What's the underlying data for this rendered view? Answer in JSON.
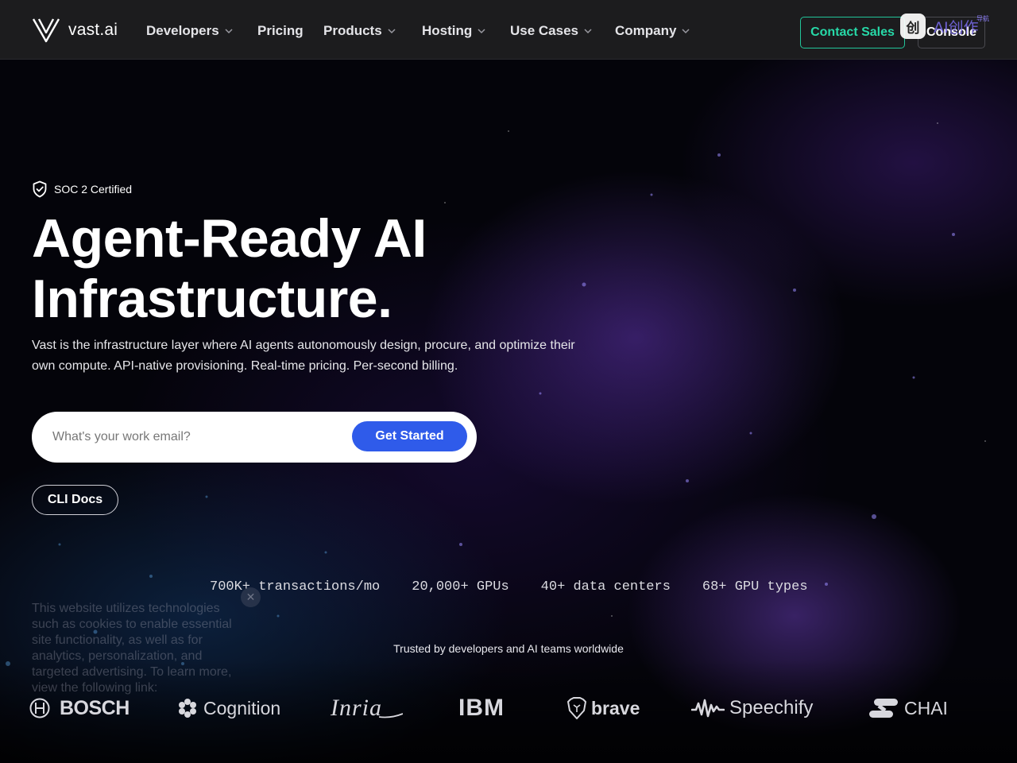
{
  "nav": {
    "brand": "vast.ai",
    "items": [
      {
        "label": "Developers",
        "dropdown": true
      },
      {
        "label": "Pricing",
        "dropdown": false
      },
      {
        "label": "Products",
        "dropdown": true
      },
      {
        "label": "Hosting",
        "dropdown": true
      },
      {
        "label": "Use Cases",
        "dropdown": true
      },
      {
        "label": "Company",
        "dropdown": true
      }
    ],
    "contact_label": "Contact Sales",
    "console_label": "Console"
  },
  "overlay": {
    "icon_text": "创",
    "text": "AI创作",
    "sub": "导航"
  },
  "hero": {
    "badge": "SOC 2 Certified",
    "headline_line1": "Agent-Ready AI",
    "headline_line2": "Infrastructure.",
    "subhead_line1": "Vast is the infrastructure layer where AI agents autonomously design, procure, and optimize their",
    "subhead_line2": "own compute. API-native provisioning. Real-time pricing. Per-second billing.",
    "email_placeholder": "What's your work email?",
    "cta_label": "Get Started",
    "cli_label": "CLI Docs"
  },
  "stats": [
    "700K+ transactions/mo",
    "20,000+ GPUs",
    "40+ data centers",
    "68+ GPU types"
  ],
  "cookie": {
    "text": "This website utilizes technologies such as cookies to enable essential site functionality, as well as for analytics, personalization, and targeted advertising. To learn more, view the following link:",
    "close": "✕"
  },
  "trusted": "Trusted by developers and AI teams worldwide",
  "logos": [
    "BOSCH",
    "Cognition",
    "Inria",
    "IBM",
    "brave",
    "Speechify",
    "CHAI"
  ],
  "colors": {
    "accent_green": "#27d9a8",
    "cta_blue": "#2f5bea",
    "nav_bg": "#1c1c1e"
  },
  "icons": {
    "brand": "vast-v-logo-icon",
    "badge": "shield-check-icon",
    "dropdown": "chevron-down-icon"
  }
}
